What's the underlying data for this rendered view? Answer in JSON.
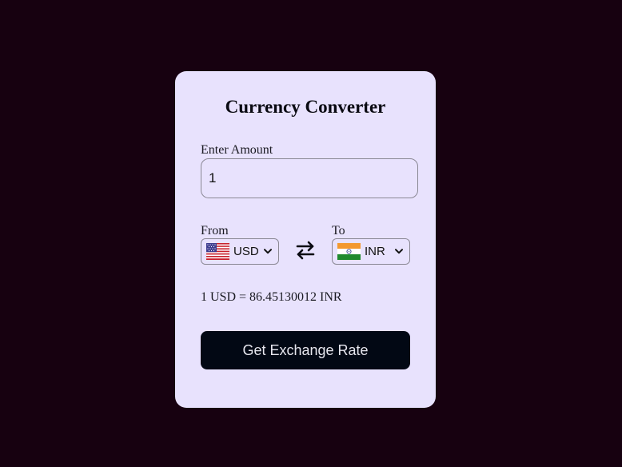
{
  "title": "Currency Converter",
  "amount": {
    "label": "Enter Amount",
    "value": "1"
  },
  "from": {
    "label": "From",
    "currency": "USD",
    "flag_icon": "us-flag-icon"
  },
  "to": {
    "label": "To",
    "currency": "INR",
    "flag_icon": "india-flag-icon"
  },
  "swap_icon": "swap-arrows-icon",
  "rate_text": "1 USD = 86.45130012 INR",
  "button_label": "Get Exchange Rate",
  "colors": {
    "background": "#170110",
    "card": "#e8e2fd",
    "button": "#020814",
    "button_text": "#e6e6ee"
  }
}
